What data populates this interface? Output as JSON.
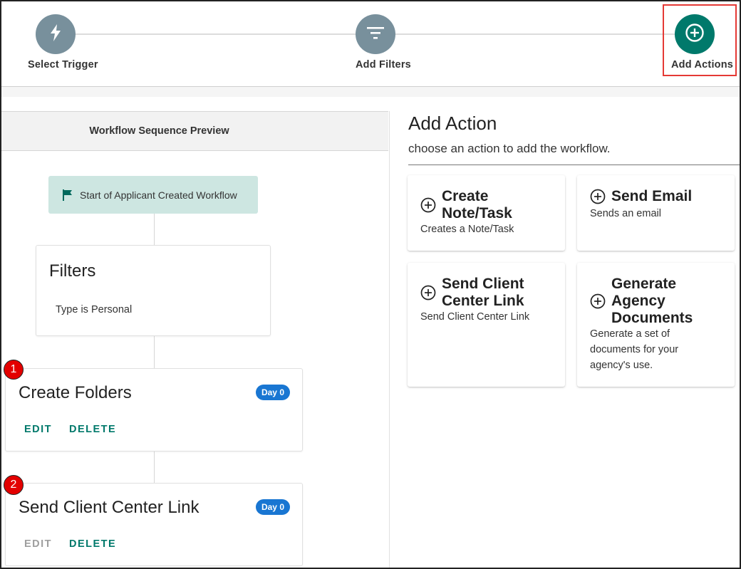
{
  "stepper": {
    "steps": [
      {
        "label": "Select Trigger",
        "icon": "bolt-icon"
      },
      {
        "label": "Add Filters",
        "icon": "filter-icon"
      },
      {
        "label": "Add Actions",
        "icon": "plus-circle-icon"
      }
    ],
    "active_color": "#00796b",
    "inactive_color": "#78909c",
    "highlight_color": "#e53935"
  },
  "preview": {
    "header": "Workflow Sequence Preview",
    "start_label": "Start of Applicant Created Workflow",
    "filters": {
      "title": "Filters",
      "text": "Type is Personal"
    },
    "actions": [
      {
        "number": "1",
        "title": "Create Folders",
        "badge": "Day 0",
        "edit": "EDIT",
        "delete": "DELETE"
      },
      {
        "number": "2",
        "title": "Send Client Center Link",
        "badge": "Day 0",
        "edit": "EDIT",
        "delete": "DELETE"
      }
    ]
  },
  "add_action": {
    "title": "Add Action",
    "subtitle": "choose an action to add the workflow.",
    "options": [
      {
        "title_lines": [
          "Create",
          "Note/Task"
        ],
        "description": "Creates a Note/Task"
      },
      {
        "title_lines": [
          "Send Email"
        ],
        "description": "Sends an email"
      },
      {
        "title_lines": [
          "Send Client",
          "Center Link"
        ],
        "description": "Send Client Center Link"
      },
      {
        "title_lines": [
          "Generate",
          "Agency",
          "Documents"
        ],
        "description_lines": [
          "Generate a set of",
          "documents for your",
          "agency's use."
        ]
      }
    ]
  }
}
